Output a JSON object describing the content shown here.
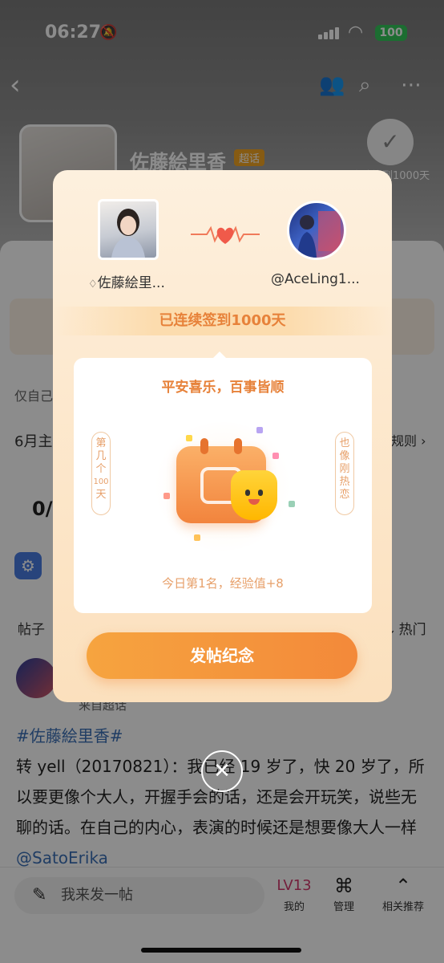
{
  "status_bar": {
    "time": "06:27",
    "battery": "100"
  },
  "profile": {
    "name": "佐藤絵里香",
    "tag": "超话",
    "checkin_text": "连续签到1000天"
  },
  "background": {
    "only_self_visible": "仅自己",
    "month_prefix": "6月主",
    "rules_link": "规则 ›",
    "counter": "0/",
    "tab_posts": "帖子",
    "tab_hot": "⇅ 热门",
    "source": "来自超话",
    "post_hashtag": "#佐藤絵里香#",
    "post_text": "转 yell（20170821）：我已经 19 岁了，快 20 岁了，所以要更像个大人，开握手会的话，还是会开玩笑，说些无聊的话。在自己的内心，表演的时候还是想要像大人一样 ",
    "post_mention": "@SatoErika"
  },
  "bottom_bar": {
    "compose_placeholder": "我来发一帖",
    "items": [
      {
        "label": "我的",
        "icon": "profile-icon",
        "badge": "LV13"
      },
      {
        "label": "管理",
        "icon": "command-icon"
      },
      {
        "label": "相关推荐",
        "icon": "recommend-icon"
      }
    ]
  },
  "modal": {
    "left_name": "佐藤絵里...",
    "right_name": "@AceLing1...",
    "streak_banner": "已连续签到1000天",
    "greeting": "平安喜乐，百事皆顺",
    "left_side": [
      "第",
      "几",
      "个",
      "100",
      "天"
    ],
    "right_side": [
      "也",
      "像",
      "刚",
      "热",
      "恋"
    ],
    "rank_text": "今日第1名，经验值+8",
    "button_label": "发帖纪念",
    "colors": {
      "accent": "#e7823a",
      "button": "#f3893a"
    }
  }
}
